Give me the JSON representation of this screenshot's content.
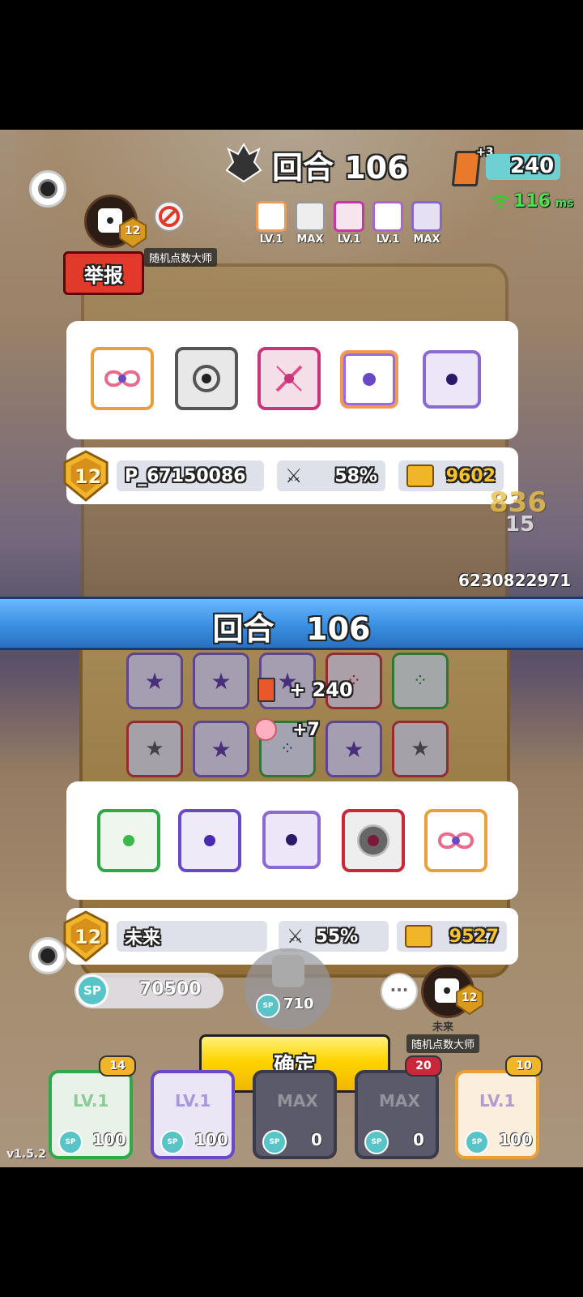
{
  "top": {
    "round_label": "回合 106",
    "card_plus": "+3",
    "card_count": "240",
    "ping_value": "116",
    "ping_unit": "ms",
    "mini_levels": [
      "LV.1",
      "MAX",
      "LV.1",
      "LV.1",
      "MAX"
    ],
    "opponent_badge_level": "12",
    "opponent_title": "随机点数大师",
    "report_button": "举报"
  },
  "opponent": {
    "name": "P_67150086",
    "win_rate": "58%",
    "trophies": "9602",
    "level": "12",
    "dice": [
      "rainbow-infinity",
      "silver-vortex",
      "pink-sword",
      "rainbow-frame-dot",
      "purple-cracked"
    ]
  },
  "battle": {
    "floating_numbers": [
      "836",
      "15"
    ],
    "score": "6230822971",
    "banner": "回合   106",
    "card_gain": "+ 240",
    "peach_gain": "+7"
  },
  "player": {
    "name": "未来",
    "win_rate": "55%",
    "trophies": "9527",
    "level": "12",
    "dice": [
      "green-wind",
      "purple-orb",
      "purple-cracked",
      "red-blade",
      "rainbow-infinity"
    ],
    "sp_label": "SP",
    "sp_value": "70500",
    "summon_cost": "710",
    "self_badge_level": "12",
    "self_name_small": "未来",
    "self_title": "随机点数大师",
    "chat_dots": "···"
  },
  "confirm_button": "确定",
  "version": "v1.5.2",
  "deck": [
    {
      "level_badge": "14",
      "level": "LV.1",
      "cost": "100"
    },
    {
      "level_badge": "",
      "level": "LV.1",
      "cost": "100"
    },
    {
      "level_badge": "",
      "level": "MAX",
      "cost": "0"
    },
    {
      "level_badge": "20",
      "level": "MAX",
      "cost": "0"
    },
    {
      "level_badge": "10",
      "level": "LV.1",
      "cost": "100"
    }
  ],
  "colors": {
    "report_red": "#e23a2a",
    "confirm_yellow": "#ffd400",
    "banner_blue": "#3a8fe0",
    "gold": "#f1b52a"
  }
}
